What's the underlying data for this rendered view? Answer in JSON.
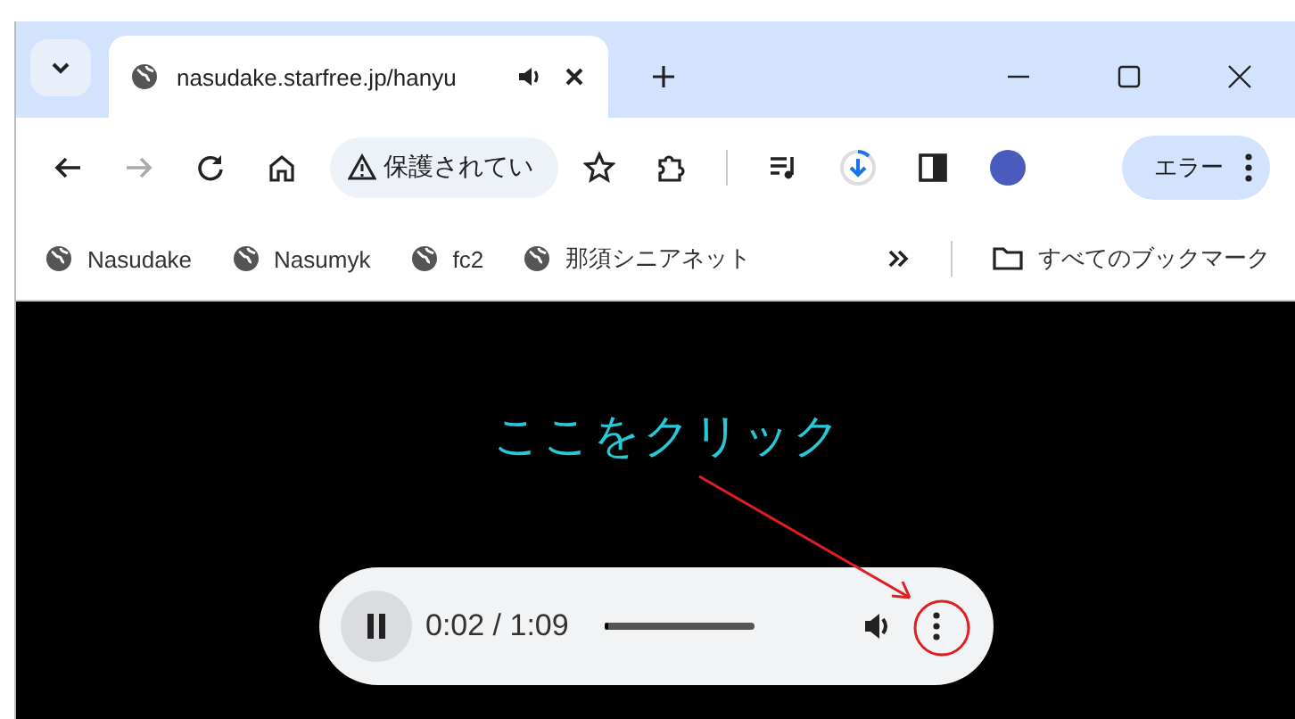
{
  "tab": {
    "title": "nasudake.starfree.jp/hanyu",
    "audio_playing": true
  },
  "toolbar": {
    "forward_disabled": true,
    "security_label": "保護されてい",
    "error_label": "エラー"
  },
  "bookmarks": [
    {
      "label": "Nasudake"
    },
    {
      "label": "Nasumyk"
    },
    {
      "label": "fc2"
    },
    {
      "label": "那須シニアネット"
    }
  ],
  "all_bookmarks": "すべてのブックマーク",
  "content": {
    "annotation": "ここをクリック",
    "player": {
      "playing": true,
      "time": "0:02 / 1:09",
      "level": 0.03
    }
  }
}
